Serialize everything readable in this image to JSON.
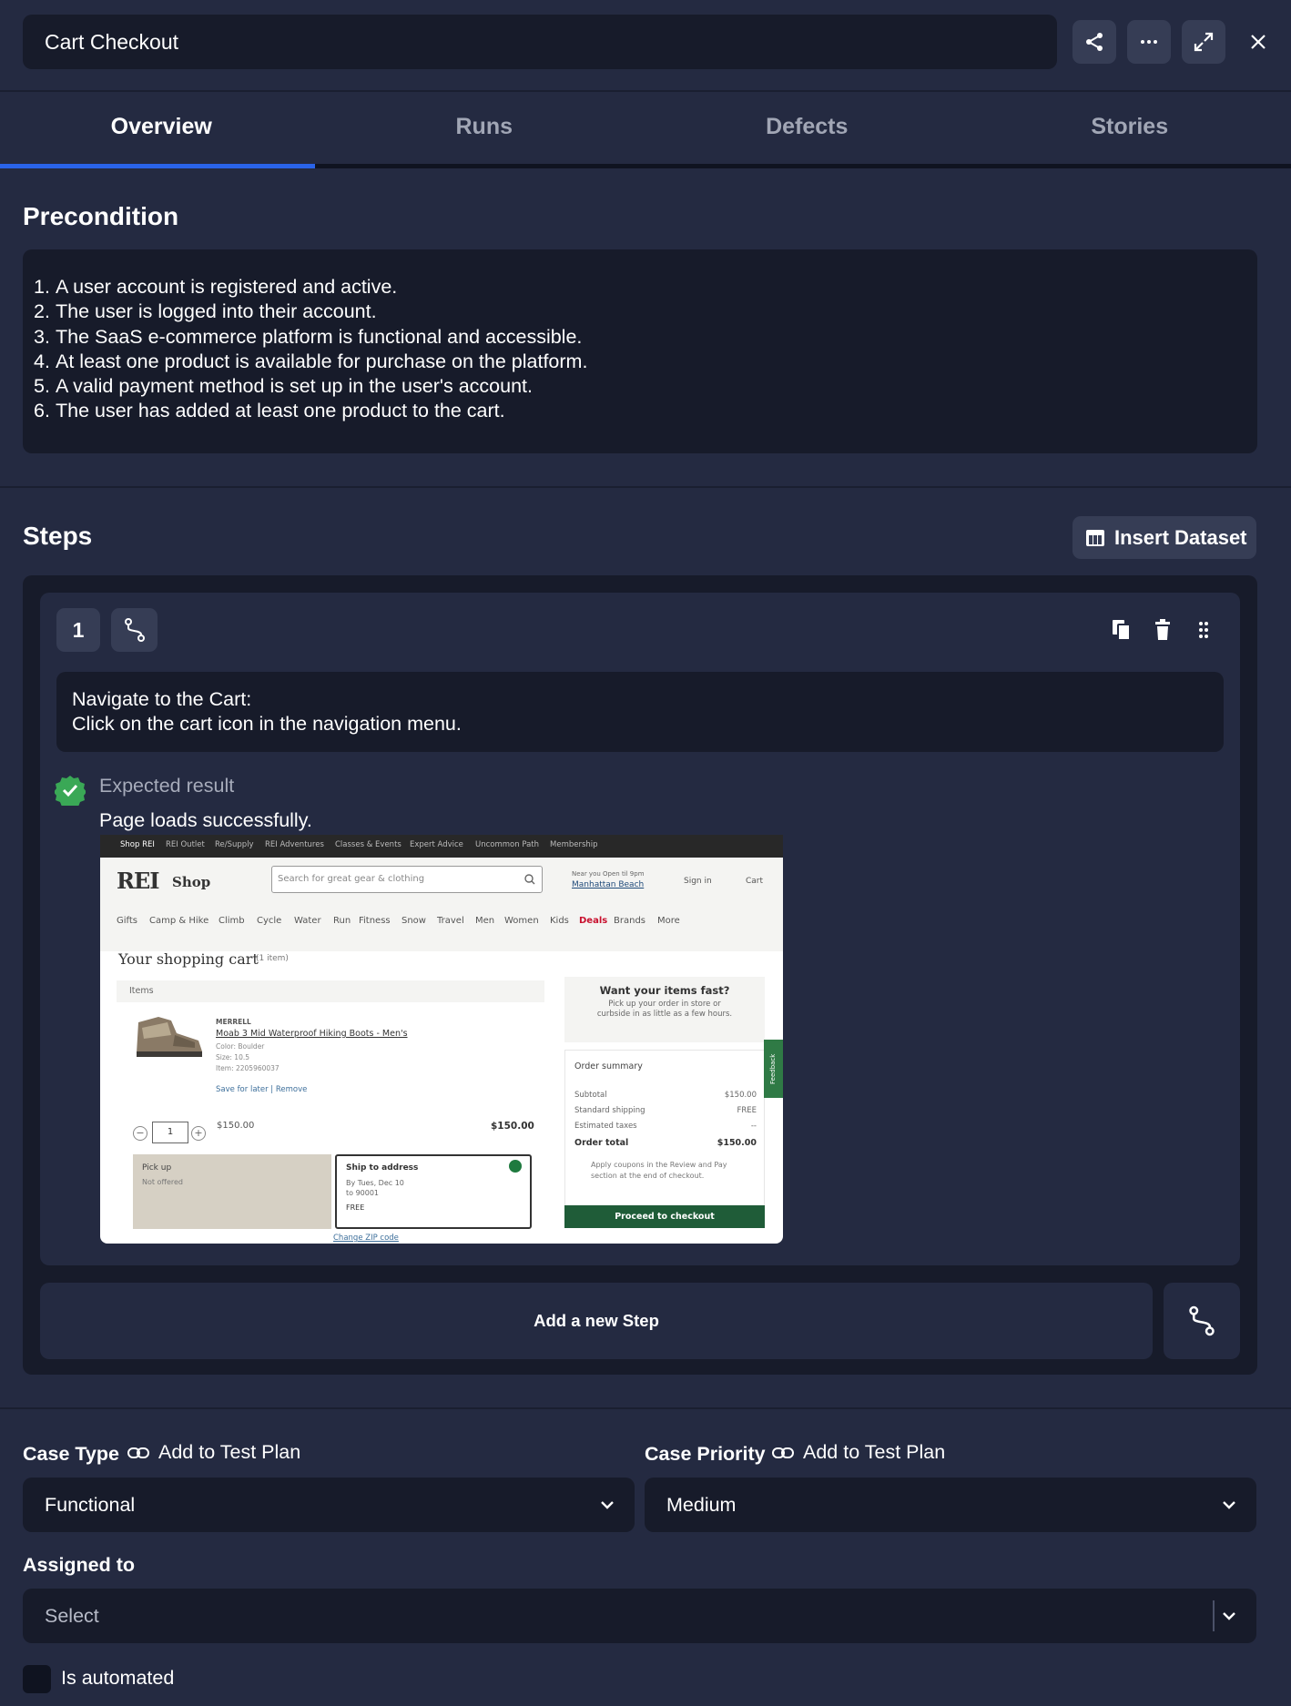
{
  "header": {
    "title": "Cart Checkout"
  },
  "tabs": [
    "Overview",
    "Runs",
    "Defects",
    "Stories"
  ],
  "active_tab": "Overview",
  "precondition": {
    "title": "Precondition",
    "items": [
      "A user account is registered and active.",
      "The user is logged into their account.",
      "The SaaS e-commerce platform is functional and accessible.",
      "At least one product is available for purchase on the platform.",
      "A valid payment method is set up in the user's account.",
      "The user has added at least one product to the cart."
    ]
  },
  "steps": {
    "title": "Steps",
    "insert_dataset_label": "Insert Dataset",
    "add_step_label": "Add a new Step",
    "items": [
      {
        "number": "1",
        "action_line1": "Navigate to the Cart:",
        "action_line2": "Click on the cart icon in the navigation menu.",
        "expected_label": "Expected result",
        "expected_text": "Page loads successfully.",
        "screenshot": {
          "topbar_links": [
            "Shop REI",
            "REI Outlet",
            "Re/Supply",
            "REI Adventures",
            "Classes & Events",
            "Expert Advice",
            "Uncommon Path",
            "Membership"
          ],
          "logo": "REI",
          "logo_sub": "Shop",
          "search_placeholder": "Search for great gear & clothing",
          "near_you": "Near you  Open til 9pm",
          "store_link": "Manhattan Beach",
          "sign_in": "Sign in",
          "cart": "Cart",
          "nav": [
            "Gifts",
            "Camp & Hike",
            "Climb",
            "Cycle",
            "Water",
            "Run",
            "Fitness",
            "Snow",
            "Travel",
            "Men",
            "Women",
            "Kids",
            "Deals",
            "Brands",
            "More"
          ],
          "cart_title": "Your shopping cart",
          "cart_count": "(1 item)",
          "items_header": "Items",
          "brand": "MERRELL",
          "product_name": "Moab 3 Mid Waterproof Hiking Boots - Men's",
          "product_color": "Color: Boulder",
          "product_size": "Size: 10.5",
          "product_item": "Item: 2205960037",
          "save_for_later": "Save for later",
          "remove": "Remove",
          "quantity": "1",
          "unit_price": "$150.00",
          "line_total": "$150.00",
          "pickup_title": "Pick up",
          "pickup_note": "Not offered",
          "ship_title": "Ship to address",
          "ship_by": "By Tues, Dec 10",
          "ship_to": "to 90001",
          "ship_cost": "FREE",
          "change_zip": "Change ZIP code",
          "fast_title": "Want your items fast?",
          "fast_line1": "Pick up your order in store or",
          "fast_line2": "curbside in as little as a few hours.",
          "summary_title": "Order summary",
          "subtotal_label": "Subtotal",
          "subtotal_value": "$150.00",
          "shipping_label": "Standard shipping",
          "shipping_value": "FREE",
          "taxes_label": "Estimated taxes",
          "taxes_value": "--",
          "total_label": "Order total",
          "total_value": "$150.00",
          "coupon_line1": "Apply coupons in the Review and Pay",
          "coupon_line2": "section at the end of checkout.",
          "checkout_button": "Proceed to checkout",
          "feedback_tab": "Feedback"
        }
      }
    ]
  },
  "form": {
    "case_type_label": "Case Type",
    "case_type_link": "Add to Test Plan",
    "case_type_value": "Functional",
    "case_priority_label": "Case Priority",
    "case_priority_link": "Add to Test Plan",
    "case_priority_value": "Medium",
    "assigned_label": "Assigned to",
    "assigned_placeholder": "Select",
    "automated_label": "Is automated",
    "automated_checked": false
  },
  "colors": {
    "background": "#242a41",
    "panel": "#171b2a",
    "button": "#363d55",
    "accent": "#2a63e8",
    "success": "#3aa856"
  }
}
